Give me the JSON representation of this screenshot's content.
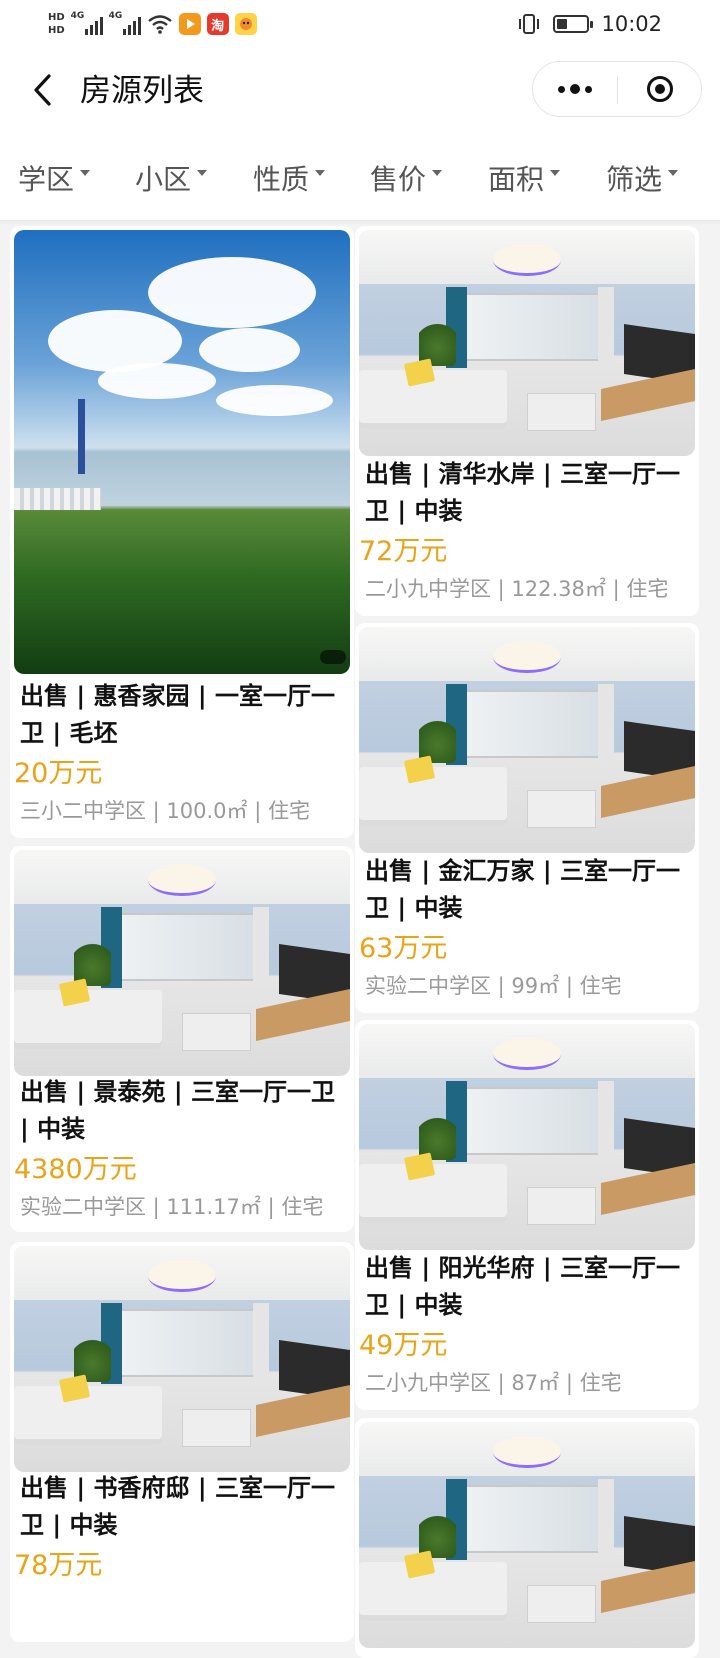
{
  "status_bar": {
    "hd1": "HD",
    "hd2": "HD",
    "net1": "4G",
    "net2": "4G",
    "taobao_icon_char": "淘",
    "time": "10:02",
    "battery_level": 0.34
  },
  "nav": {
    "title": "房源列表"
  },
  "filters": [
    {
      "label": "学区"
    },
    {
      "label": "小区"
    },
    {
      "label": "性质"
    },
    {
      "label": "售价"
    },
    {
      "label": "面积"
    },
    {
      "label": "筛选"
    }
  ],
  "listings": [
    {
      "title": "出售 | 惠香家园 | 一室一厅一卫 | 毛坯",
      "price": "20万元",
      "meta": "三小二中学区 | 100.0㎡ | 住宅",
      "photo": "lake-photo"
    },
    {
      "title": "出售 | 清华水岸 | 三室一厅一卫 | 中装",
      "price": "72万元",
      "meta": "二小九中学区 | 122.38㎡ | 住宅",
      "photo": "living-room-photo"
    },
    {
      "title": "出售 | 金汇万家 | 三室一厅一卫 | 中装",
      "price": "63万元",
      "meta": "实验二中学区 | 99㎡ | 住宅",
      "photo": "living-room-photo"
    },
    {
      "title": "出售 | 景泰苑 | 三室一厅一卫 | 中装",
      "price": "4380万元",
      "meta": "实验二中学区 | 111.17㎡ | 住宅",
      "photo": "living-room-photo"
    },
    {
      "title": "出售 | 阳光华府 | 三室一厅一卫 | 中装",
      "price": "49万元",
      "meta": "二小九中学区 | 87㎡ | 住宅",
      "photo": "living-room-photo"
    },
    {
      "title": "出售 | 书香府邸 | 三室一厅一卫 | 中装",
      "price": "78万元",
      "meta": "",
      "photo": "living-room-photo"
    },
    {
      "title": "",
      "price": "",
      "meta": "",
      "photo": "living-room-photo"
    }
  ],
  "colors": {
    "price": "#e9a317",
    "meta": "#999999",
    "background": "#f3f3f3"
  }
}
